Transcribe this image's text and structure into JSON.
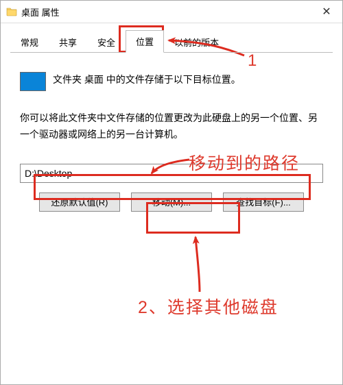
{
  "colors": {
    "annotation_red": "#dd2b1f",
    "icon_blue": "#0a84d8"
  },
  "titlebar": {
    "title": "桌面 属性",
    "close_glyph": "✕"
  },
  "tabs": {
    "general": "常规",
    "share": "共享",
    "security": "安全",
    "location": "位置",
    "previous": "以前的版本"
  },
  "panel": {
    "info": "文件夹 桌面 中的文件存储于以下目标位置。",
    "desc": "你可以将此文件夹中文件存储的位置更改为此硬盘上的另一个位置、另一个驱动器或网络上的另一台计算机。",
    "path_value": "D:\\Desktop"
  },
  "buttons": {
    "restore": "还原默认值(R)",
    "move": "移动(M)...",
    "find": "查找目标(F)..."
  },
  "annotations": {
    "step1": "1",
    "step2_label": "2、选择其他磁盘",
    "path_label": "移动到的路径"
  }
}
